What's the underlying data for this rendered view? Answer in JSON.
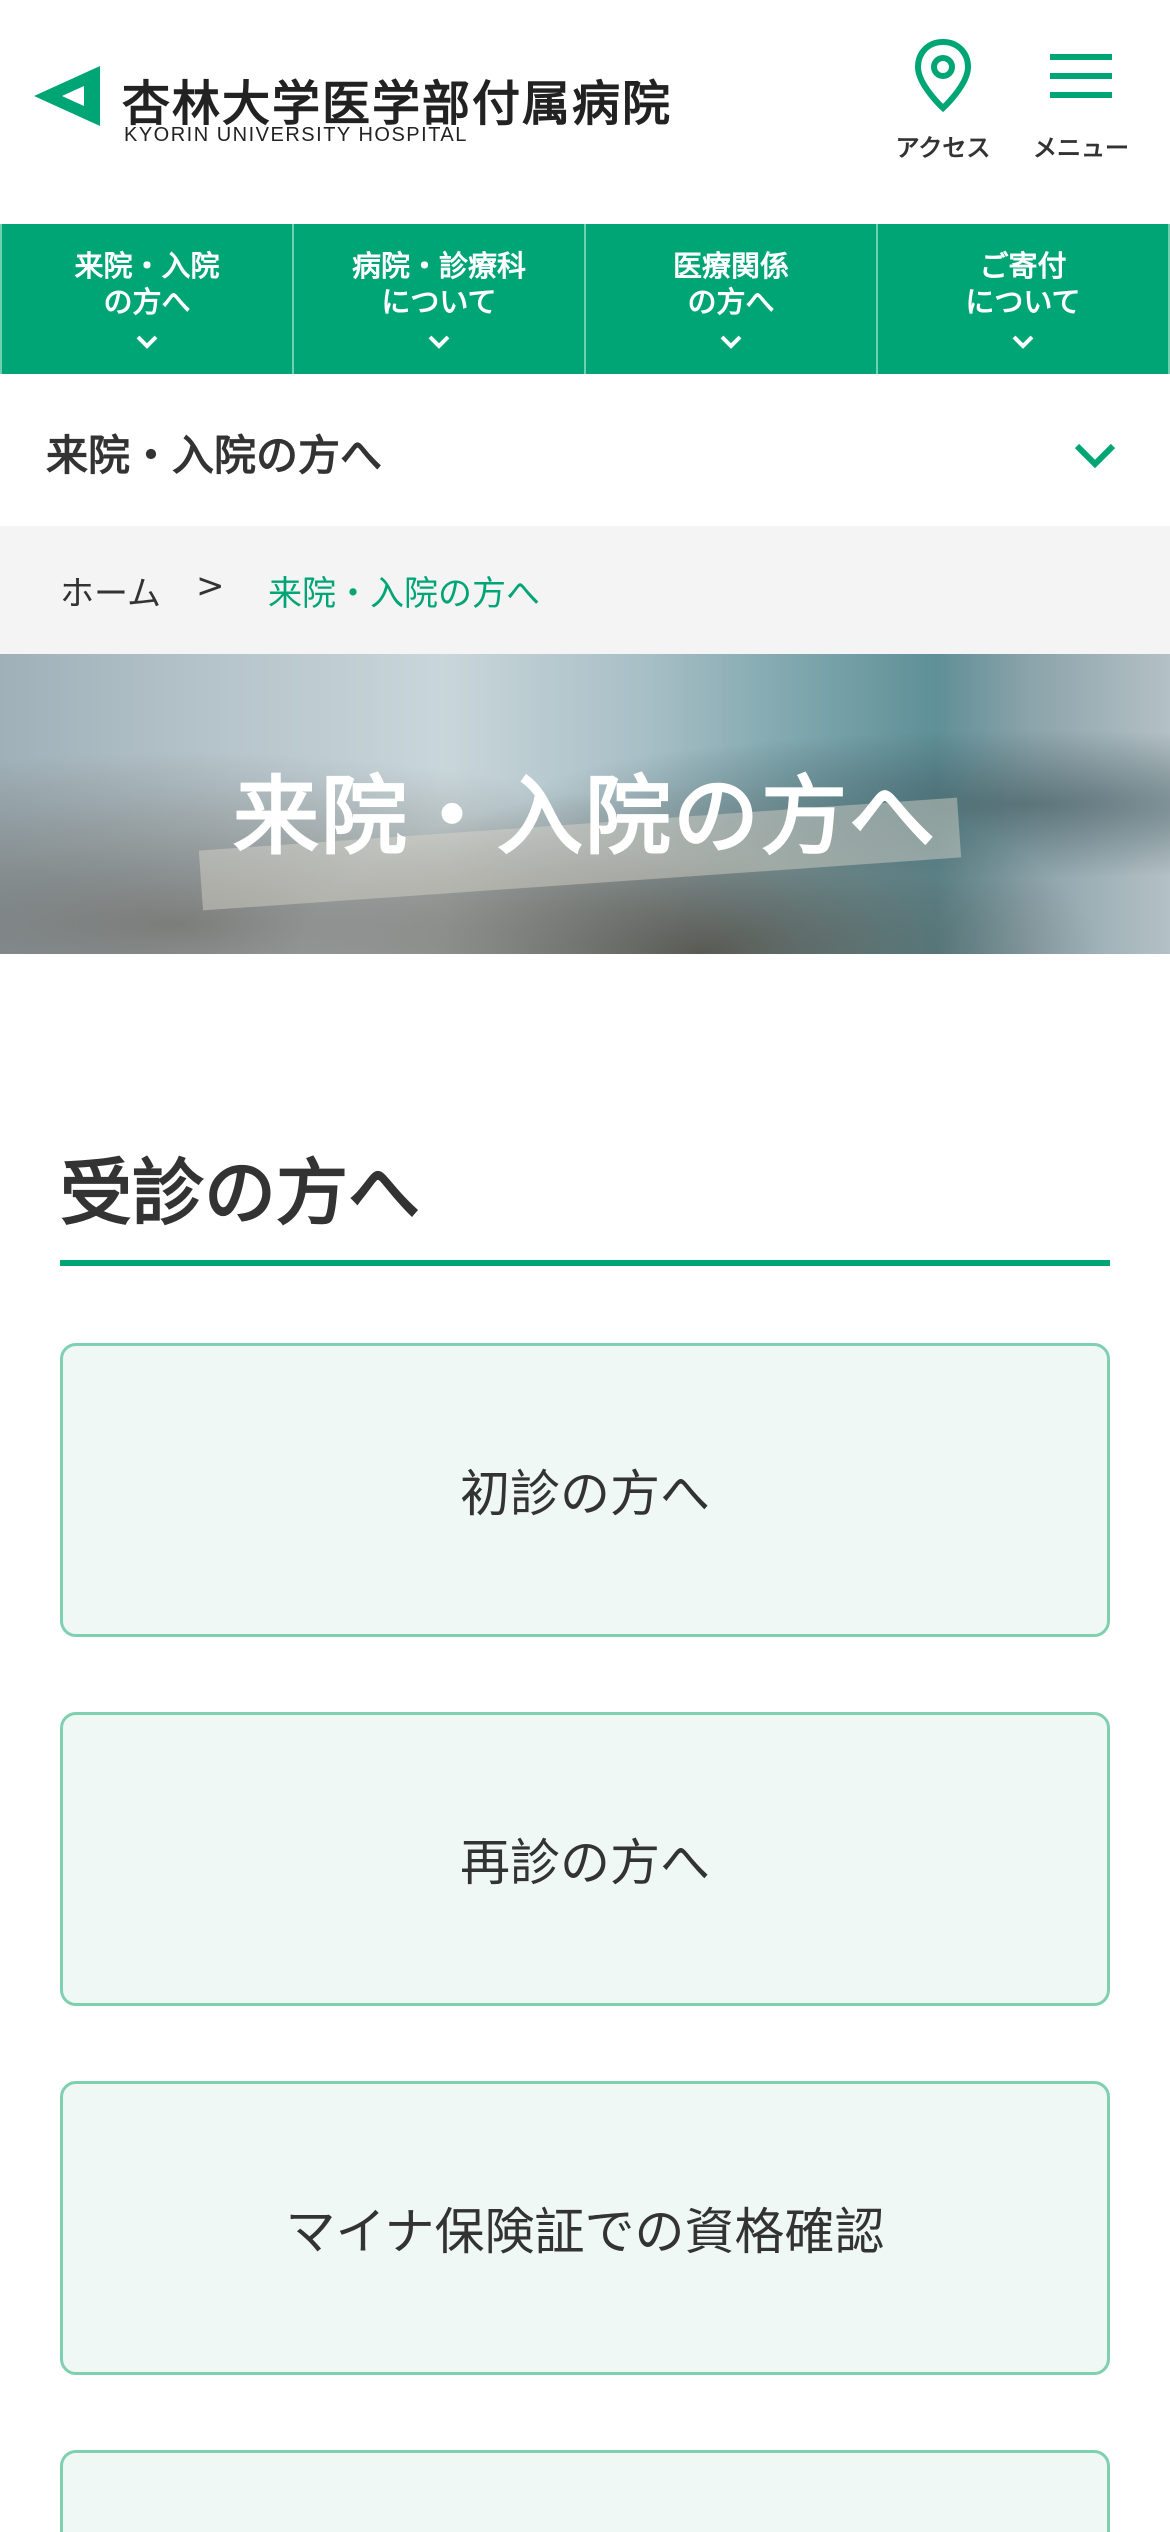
{
  "header": {
    "logo_jp": "杏林大学医学部付属病院",
    "logo_en": "KYORIN UNIVERSITY HOSPITAL",
    "access_label": "アクセス",
    "menu_label": "メニュー"
  },
  "global_nav": {
    "items": [
      {
        "line1": "来院・入院",
        "line2": "の方へ"
      },
      {
        "line1": "病院・診療科",
        "line2": "について"
      },
      {
        "line1": "医療関係",
        "line2": "の方へ"
      },
      {
        "line1": "ご寄付",
        "line2": "について"
      }
    ]
  },
  "sub_nav": {
    "title": "来院・入院の方へ"
  },
  "breadcrumb": {
    "home": "ホーム",
    "separator": ">",
    "current": "来院・入院の方へ"
  },
  "hero": {
    "title": "来院・入院の方へ"
  },
  "section": {
    "title": "受診の方へ",
    "cards": [
      {
        "label": "初診の方へ"
      },
      {
        "label": "再診の方へ"
      },
      {
        "label": "マイナ保険証での資格確認"
      },
      {
        "label": ""
      }
    ]
  },
  "colors": {
    "brand_green": "#00a576",
    "card_bg": "#eff8f4",
    "card_border": "#7fd0b2",
    "breadcrumb_bg": "#f4f4f4"
  },
  "icons": [
    "logo-triangle-icon",
    "map-pin-icon",
    "hamburger-icon",
    "chevron-down-icon"
  ]
}
